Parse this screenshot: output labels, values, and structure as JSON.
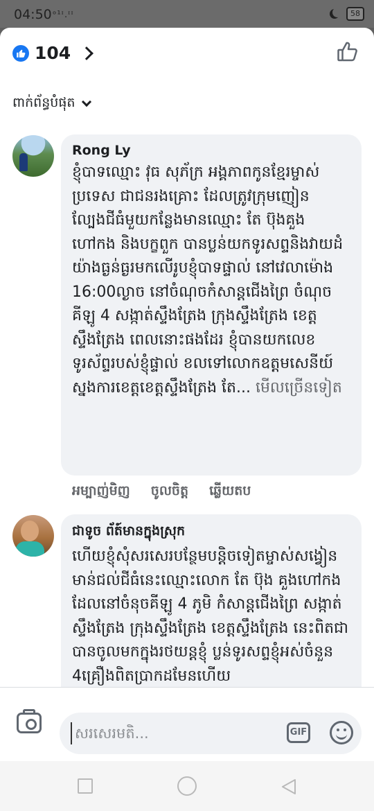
{
  "status_bar": {
    "time": "04:50",
    "signal": "ᵒ¹ᶦ.ᶦᶦ",
    "battery": "58"
  },
  "header": {
    "reaction_count": "104",
    "reaction_icon": "like-icon",
    "like_button_icon": "thumbs-up-icon"
  },
  "sort": {
    "label": "ពាក់ព័ន្ធបំផុត"
  },
  "comments": [
    {
      "author": "Rong Ly",
      "text": "ខ្ញុំបាទឈ្មោះ វុធ សុភ័ក្រ អង្គភាពកូនខ្មែរម្ចាស់ប្រទេស ជាជនរងគ្រោះ ដែលត្រូវក្រុមញៀនល្បែងជីធំមួយកន្លែងមានឈ្មោះ តែ ប៊ុងគួង ហៅកង និងបក្ខពួក បានប្លន់យកទូរសព្ទនិងវាយដំយ៉ាងធ្ងន់ធ្ងរមកលើរូបខ្ញុំបាទផ្ទាល់ នៅវេលាម៉ោង 16:00ល្ងាច នៅចំណុចកំសាន្តជើងព្រៃ ចំណុចគីឡូ 4 សង្កាត់ស្ទឹងត្រែង ក្រុងស្ទឹងត្រែង ខេត្តស្ទឹងត្រែង ពេលនោះផងដែរ ខ្ញុំបានយកលេខទូរស័ព្ទរបស់ខ្ញុំផ្ទាល់ ខលទៅលោកឧត្តមសេនីយ៍ស្នងការខេត្តខេត្តស្ទឹងត្រែង តែ...",
      "see_more": "មើលច្រើនទៀត",
      "actions": {
        "like": "អម្បាញ់មិញ",
        "love": "ចូលចិត្ត",
        "reply": "ឆ្លើយតប"
      }
    },
    {
      "author": "ជាទូច ព័ត៍មានក្នុងស្រុក",
      "text": "ហើយខ្ញុំសុំសរសេរបន្ថែមបន្តិចទៀតម្ចាស់សង្វៀនមាន់ជល់ជីធំនេះឈ្មោះលោក តែ ប៊ុង គួងហៅកង ដែលនៅចំនុចគីឡូ 4 ភូមិ កំសាន្តជើងព្រៃ សង្កាត់ស្ទឹងត្រែង ក្រុងស្ទឹងត្រែង ខេត្តស្ទឹងត្រែង នេះពិតជាបានចូលមកក្នុងរថយន្តខ្ញុំ ប្លន់ទូរសព្ទខ្ញុំអស់ចំនួន 4គ្រឿងពិតប្រាកដមែនហើយ"
    }
  ],
  "composer": {
    "placeholder": "សរសេរមតិ...",
    "gif_label": "GIF"
  }
}
